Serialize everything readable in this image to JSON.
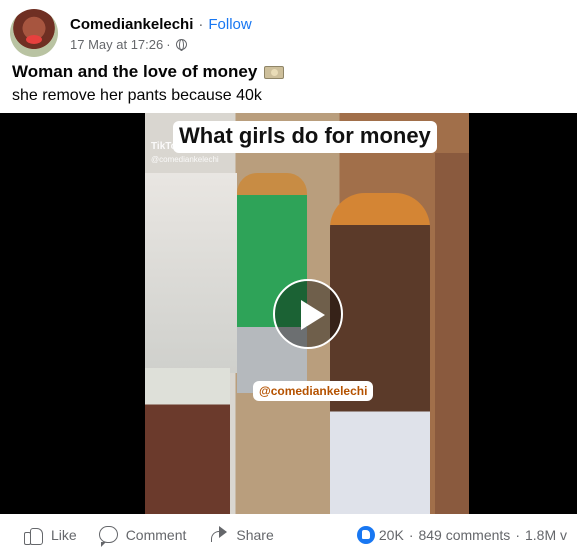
{
  "post": {
    "author": "Comediankelechi",
    "separator": "·",
    "follow_label": "Follow",
    "timestamp": "17 May at 17:26",
    "time_separator": "·",
    "privacy_icon": "globe-icon",
    "title": "Woman and the love of money",
    "title_icon": "money-icon",
    "text": "she remove her pants because 40k"
  },
  "video": {
    "overlay_title": "What girls do for money",
    "brand": "TikTok",
    "handle_small": "@comediankelechi",
    "handle_tag": "@comediankelechi",
    "play_icon": "play-icon"
  },
  "actions": {
    "like": "Like",
    "comment": "Comment",
    "share": "Share"
  },
  "stats": {
    "reactions": "20K",
    "sep1": "·",
    "comments": "849 comments",
    "sep2": "·",
    "views": "1.8M v"
  },
  "colors": {
    "accent": "#1877f2",
    "secondary_text": "#65676b"
  }
}
